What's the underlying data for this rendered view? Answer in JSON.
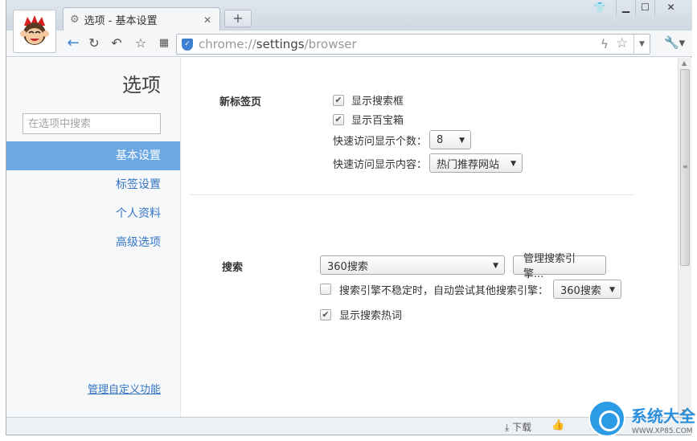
{
  "tab": {
    "title": "选项 - 基本设置",
    "new_tab": "+"
  },
  "toolbar": {
    "url_scheme": "chrome://",
    "url_host": "settings",
    "url_path": "/browser"
  },
  "sidebar": {
    "title": "选项",
    "search_placeholder": "在选项中搜索",
    "items": [
      {
        "label": "基本设置",
        "active": true
      },
      {
        "label": "标签设置"
      },
      {
        "label": "个人资料"
      },
      {
        "label": "高级选项"
      }
    ],
    "manage_link": "管理自定义功能"
  },
  "newtab_section": {
    "label": "新标签页",
    "show_search_box": "显示搜索框",
    "show_treasure_box": "显示百宝箱",
    "quick_count_label": "快速访问显示个数：",
    "quick_count_value": "8",
    "quick_content_label": "快速访问显示内容：",
    "quick_content_value": "热门推荐网站"
  },
  "search_section": {
    "label": "搜索",
    "engine_value": "360搜索",
    "manage_button": "管理搜索引擎...",
    "fallback_label": "搜索引擎不稳定时，自动尝试其他搜索引擎：",
    "fallback_value": "360搜索",
    "show_hot_words": "显示搜索热词"
  },
  "statusbar": {
    "download": "下载"
  },
  "watermark": {
    "text": "系统大全",
    "sub": "WWW.XP85.COM"
  },
  "colors": {
    "accent": "#6ca9e3",
    "link": "#3576c6"
  }
}
